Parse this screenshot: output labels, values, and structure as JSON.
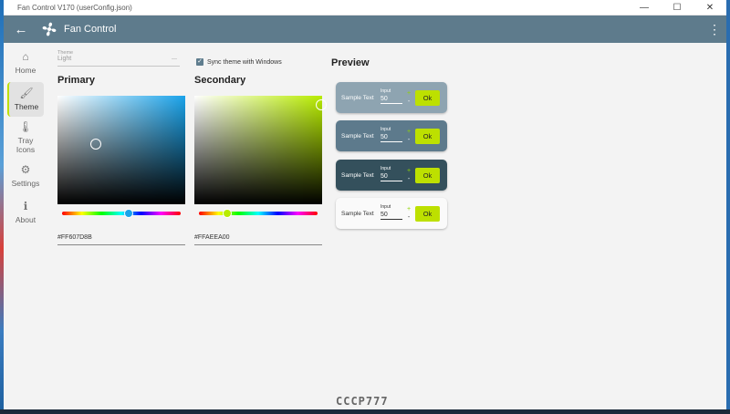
{
  "window": {
    "title": "Fan Control V170 (userConfig.json)",
    "minimize": "—",
    "maximize": "☐",
    "close": "✕"
  },
  "appbar": {
    "back": "←",
    "title": "Fan Control",
    "more": "⋮"
  },
  "sidebar": {
    "items": [
      {
        "icon": "⌂",
        "label": "Home"
      },
      {
        "icon": "🖌",
        "label": "Theme"
      },
      {
        "icon": "🌡",
        "label": "Tray Icons"
      },
      {
        "icon": "⚙",
        "label": "Settings"
      },
      {
        "icon": "ℹ",
        "label": "About"
      }
    ]
  },
  "theme": {
    "field_label": "Theme",
    "field_value": "Light",
    "sync_label": "Sync theme with Windows",
    "sync_checked": true
  },
  "primary": {
    "heading": "Primary",
    "hex": "#FF607D8B",
    "color": "#1aa3ea",
    "hue_position": 0.56
  },
  "secondary": {
    "heading": "Secondary",
    "hex": "#FFAEEA00",
    "color": "#b8ec00",
    "hue_position": 0.24
  },
  "preview": {
    "title": "Preview",
    "cards": [
      {
        "text": "Sample Text",
        "input_label": "Input",
        "value": "50",
        "plus": "+",
        "minus": "-",
        "ok": "Ok",
        "bg": "#8ea4b1",
        "fg": "#ffffff"
      },
      {
        "text": "Sample Text",
        "input_label": "Input",
        "value": "50",
        "plus": "+",
        "minus": "-",
        "ok": "Ok",
        "bg": "#5d7a8c",
        "fg": "#ffffff"
      },
      {
        "text": "Sample Text",
        "input_label": "Input",
        "value": "50",
        "plus": "+",
        "minus": "-",
        "ok": "Ok",
        "bg": "#34505c",
        "fg": "#ffffff"
      },
      {
        "text": "Sample Text",
        "input_label": "Input",
        "value": "50",
        "plus": "+",
        "minus": "-",
        "ok": "Ok",
        "bg": "#fafafa",
        "fg": "#333333"
      }
    ]
  },
  "watermark": "CCCP777",
  "colors": {
    "accent": "#bde000",
    "appbar": "#5e7b8c"
  }
}
